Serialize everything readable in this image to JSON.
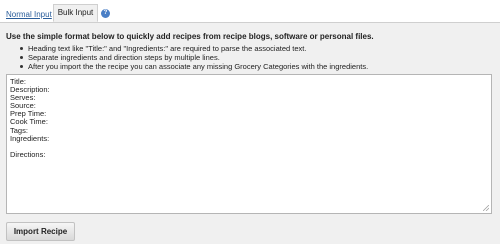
{
  "tabs": {
    "normal_label": "Normal Input",
    "bulk_label": "Bulk Input",
    "help_icon": "info-icon",
    "help_glyph": "?"
  },
  "instructions": {
    "intro": "Use the simple format below to quickly add recipes from recipe blogs, software or personal files.",
    "bullets": [
      "Heading text like \"Title:\" and \"Ingredients:\" are required to parse the associated text.",
      "Separate ingredients and direction steps by multiple lines.",
      "After you import the the recipe you can associate any missing Grocery Categories with the ingredients."
    ]
  },
  "editor": {
    "lines": [
      "Title:",
      "Description:",
      "Serves:",
      "Source:",
      "Prep Time:",
      "Cook Time:",
      "Tags:",
      "Ingredients:",
      "",
      "Directions:"
    ]
  },
  "actions": {
    "import_label": "Import Recipe"
  },
  "colors": {
    "link": "#2a5d9a",
    "panel_bg": "#f0f0f0",
    "help_icon_bg": "#4a7fc6"
  }
}
